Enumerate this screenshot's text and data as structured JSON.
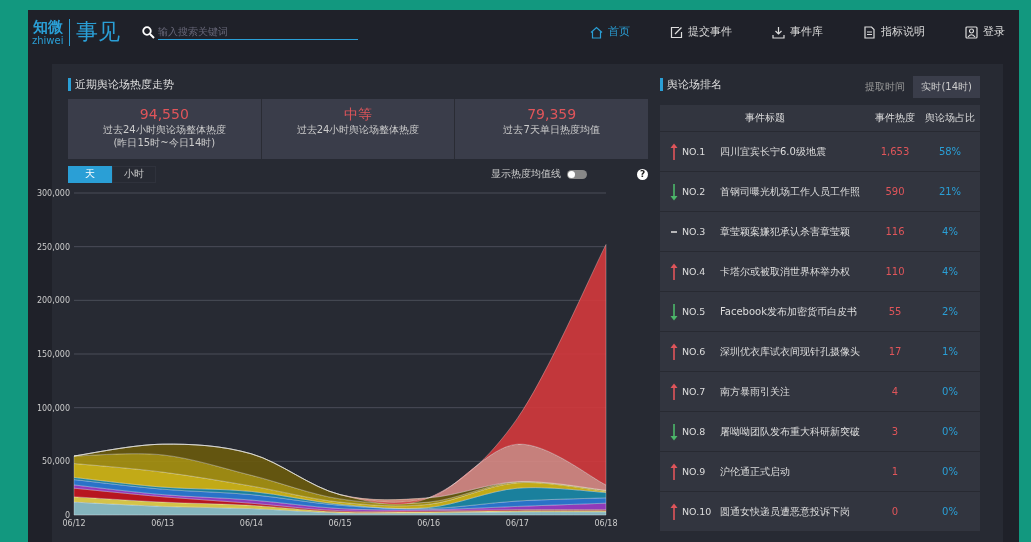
{
  "brand": {
    "logo_cn": "知微",
    "logo_en": "zhiwei",
    "product": "事见"
  },
  "search": {
    "placeholder": "输入搜索关键词"
  },
  "nav": [
    {
      "label": "首页",
      "selected": true
    },
    {
      "label": "提交事件",
      "selected": false
    },
    {
      "label": "事件库",
      "selected": false
    },
    {
      "label": "指标说明",
      "selected": false
    },
    {
      "label": "登录",
      "selected": false
    }
  ],
  "trend": {
    "title": "近期舆论场热度走势",
    "stats": [
      {
        "value": "94,550",
        "label": "过去24小时舆论场整体热度",
        "note": "(昨日15时~今日14时)"
      },
      {
        "value": "中等",
        "label": "过去24小时舆论场整体热度"
      },
      {
        "value": "79,359",
        "label": "过去7天单日热度均值"
      }
    ],
    "tabs": [
      {
        "label": "天",
        "selected": true
      },
      {
        "label": "小时",
        "selected": false
      }
    ],
    "mean_line": {
      "label": "显示热度均值线",
      "on": false
    },
    "help": "?",
    "chart_data": {
      "type": "area",
      "stacked": true,
      "categories": [
        "06/12",
        "06/13",
        "06/14",
        "06/15",
        "06/16",
        "06/17",
        "06/18"
      ],
      "ylim": [
        0,
        300000
      ],
      "grid": true,
      "yticks": [
        {
          "value": 0,
          "label": "0"
        },
        {
          "value": 50000,
          "label": "50,000"
        },
        {
          "value": 100000,
          "label": "100,000"
        },
        {
          "value": 150000,
          "label": "150,000"
        },
        {
          "value": 200000,
          "label": "200,000"
        },
        {
          "value": 250000,
          "label": "250,000"
        },
        {
          "value": 300000,
          "label": "300,000"
        }
      ],
      "series": [
        {
          "color": "#8fc3cc",
          "values": [
            12000,
            8000,
            6000,
            2000,
            2000,
            3000,
            3000
          ]
        },
        {
          "color": "#e8d44a",
          "values": [
            5000,
            4000,
            3000,
            1000,
            1000,
            1000,
            1000
          ]
        },
        {
          "color": "#c8141e",
          "values": [
            8000,
            5000,
            2000,
            1000,
            1000,
            1000,
            1000
          ]
        },
        {
          "color": "#9c3cc8",
          "values": [
            3000,
            2000,
            3000,
            2000,
            1000,
            3000,
            6000
          ]
        },
        {
          "color": "#2a7ad8",
          "values": [
            5000,
            5000,
            5000,
            3000,
            1000,
            5000,
            5000
          ]
        },
        {
          "color": "#1a8aa8",
          "values": [
            2000,
            2000,
            3000,
            1000,
            1000,
            12000,
            5000
          ]
        },
        {
          "color": "#d4b814",
          "values": [
            13000,
            14000,
            5000,
            2000,
            3000,
            5000,
            1000
          ]
        },
        {
          "color": "#a89210",
          "values": [
            7000,
            16000,
            10000,
            3000,
            2000,
            1000,
            1000
          ]
        },
        {
          "color": "#6a5a0c",
          "values": [
            0,
            10000,
            20000,
            4000,
            4000,
            0,
            0
          ]
        },
        {
          "color": "#d88a84",
          "values": [
            0,
            0,
            0,
            0,
            0,
            35000,
            5000
          ]
        },
        {
          "color": "#d4383c",
          "values": [
            0,
            0,
            0,
            0,
            0,
            24000,
            224000
          ]
        }
      ]
    }
  },
  "ranking": {
    "title": "舆论场排名",
    "time_label": "提取时间",
    "time_value": "实时(14时)",
    "columns": [
      "事件标题",
      "事件热度",
      "舆论场占比"
    ],
    "rows": [
      {
        "kind": "up",
        "rank": "NO.1",
        "title": "四川宜宾长宁6.0级地震",
        "heat": "1,653",
        "share": "58%"
      },
      {
        "kind": "down",
        "rank": "NO.2",
        "title": "首钢司曝光机场工作人员工作照",
        "heat": "590",
        "share": "21%"
      },
      {
        "kind": "flat",
        "rank": "NO.3",
        "title": "章莹颖案嫌犯承认杀害章莹颖",
        "heat": "116",
        "share": "4%"
      },
      {
        "kind": "up",
        "rank": "NO.4",
        "title": "卡塔尔或被取消世界杯举办权",
        "heat": "110",
        "share": "4%"
      },
      {
        "kind": "down",
        "rank": "NO.5",
        "title": "Facebook发布加密货币白皮书",
        "heat": "55",
        "share": "2%"
      },
      {
        "kind": "up",
        "rank": "NO.6",
        "title": "深圳优衣库试衣间现针孔摄像头",
        "heat": "17",
        "share": "1%"
      },
      {
        "kind": "up",
        "rank": "NO.7",
        "title": "南方暴雨引关注",
        "heat": "4",
        "share": "0%"
      },
      {
        "kind": "down",
        "rank": "NO.8",
        "title": "屠呦呦团队发布重大科研新突破",
        "heat": "3",
        "share": "0%"
      },
      {
        "kind": "up",
        "rank": "NO.9",
        "title": "沪伦通正式启动",
        "heat": "1",
        "share": "0%"
      },
      {
        "kind": "up",
        "rank": "NO.10",
        "title": "圆通女快递员遭恶意投诉下岗",
        "heat": "0",
        "share": "0%"
      }
    ]
  }
}
